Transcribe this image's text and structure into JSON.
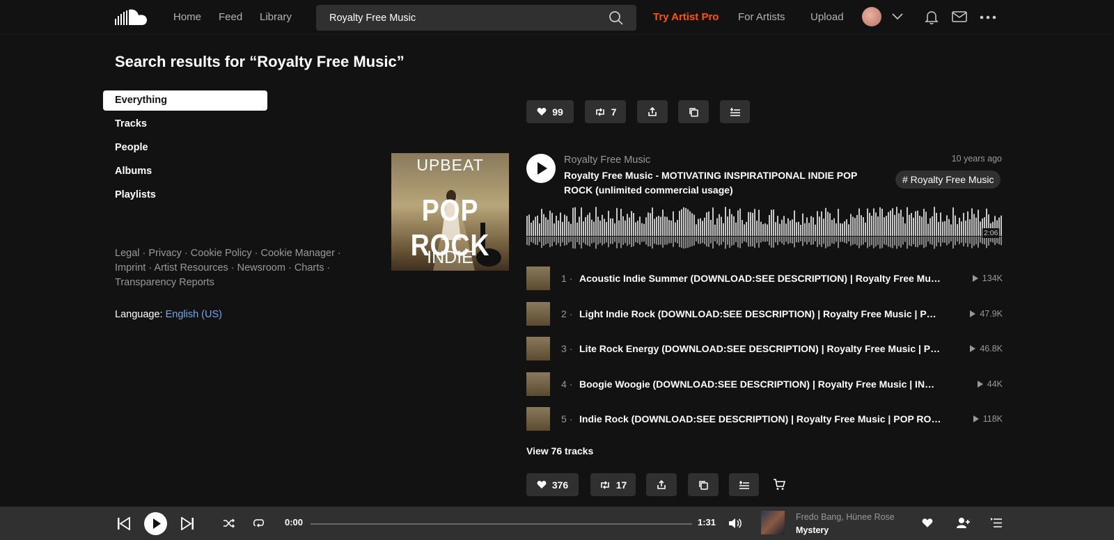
{
  "nav": {
    "home": "Home",
    "feed": "Feed",
    "library": "Library",
    "search_value": "Royalty Free Music",
    "try_pro": "Try Artist Pro",
    "for_artists": "For Artists",
    "upload": "Upload"
  },
  "page": {
    "title": "Search results for “Royalty Free Music”"
  },
  "filters": [
    "Everything",
    "Tracks",
    "People",
    "Albums",
    "Playlists"
  ],
  "footer": {
    "links": "Legal · Privacy · Cookie Policy · Cookie Manager · Imprint · Artist Resources · Newsroom · Charts · Transparency Reports",
    "language_label": "Language:",
    "language_value": "English (US)"
  },
  "result": {
    "top_actions": {
      "likes": "99",
      "reposts": "7"
    },
    "artwork": {
      "line1": "UPBEAT",
      "line2": "POP ROCK",
      "line3": "INDIE"
    },
    "artist": "Royalty Free Music",
    "title": "Royalty Free Music - MOTIVATING INSPIRATIPONAL INDIE POP ROCK (unlimited commercial usage)",
    "posted": "10 years ago",
    "tag": "# Royalty Free Music",
    "duration": "2:06",
    "tracks": [
      {
        "num": "1 ·",
        "name": "Acoustic Indie Summer (DOWNLOAD:SEE DESCRIPTION) | Royalty Free Music",
        "plays": "134K"
      },
      {
        "num": "2 ·",
        "name": "Light Indie Rock (DOWNLOAD:SEE DESCRIPTION) | Royalty Free Music | POP ROCK",
        "plays": "47.9K"
      },
      {
        "num": "3 ·",
        "name": "Lite Rock Energy (DOWNLOAD:SEE DESCRIPTION) | Royalty Free Music | POP ROCK",
        "plays": "46.8K"
      },
      {
        "num": "4 ·",
        "name": "Boogie Woogie (DOWNLOAD:SEE DESCRIPTION) | Royalty Free Music | INDIE ROCK",
        "plays": "44K"
      },
      {
        "num": "5 ·",
        "name": "Indie Rock (DOWNLOAD:SEE DESCRIPTION) | Royalty Free Music | POP ROCK",
        "plays": "118K"
      }
    ],
    "view_all": "View 76 tracks",
    "bottom_actions": {
      "likes": "376",
      "reposts": "17"
    }
  },
  "player": {
    "elapsed": "0:00",
    "total": "1:31",
    "progress": 0,
    "artist": "Fredo Bang, Hünee Rose",
    "title": "Mystery"
  },
  "colors": {
    "accent": "#ff5500",
    "link": "#74a6e8",
    "panel": "#303030",
    "background": "#121212"
  }
}
